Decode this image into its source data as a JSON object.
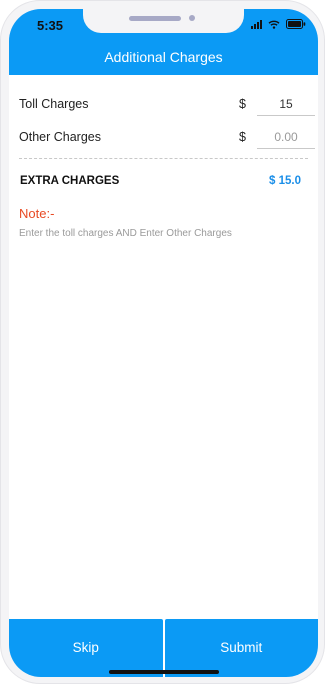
{
  "status_bar": {
    "time": "5:35",
    "icons": [
      "signal-icon",
      "wifi-icon",
      "battery-icon"
    ]
  },
  "header": {
    "title": "Additional Charges"
  },
  "charges": {
    "toll": {
      "label": "Toll Charges",
      "currency": "$",
      "value": "15",
      "placeholder": ""
    },
    "other": {
      "label": "Other Charges",
      "currency": "$",
      "value": "",
      "placeholder": "0.00"
    }
  },
  "summary": {
    "label": "EXTRA CHARGES",
    "value": "$ 15.0"
  },
  "note": {
    "title": "Note:-",
    "text": "Enter the toll charges AND Enter Other Charges"
  },
  "actions": {
    "skip_label": "Skip",
    "submit_label": "Submit"
  },
  "colors": {
    "primary": "#0b9af5",
    "extra_value": "#1a8ee8",
    "note_title": "#e84a24"
  }
}
